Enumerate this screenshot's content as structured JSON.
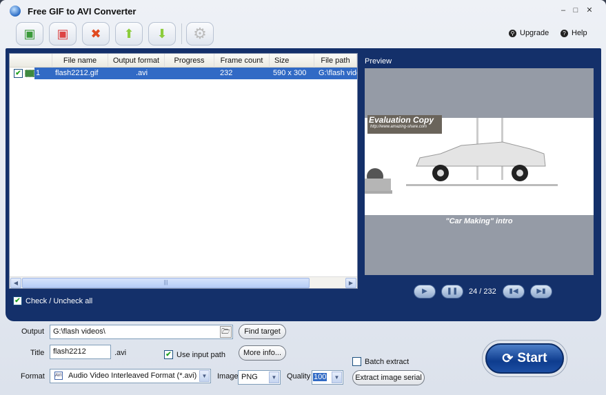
{
  "window": {
    "title": "Free GIF to AVI Converter"
  },
  "toolbar": {
    "upgrade": "Upgrade",
    "help": "Help"
  },
  "list": {
    "columns": [
      "",
      "File name",
      "Output format",
      "Progress",
      "Frame count",
      "Size",
      "File path"
    ],
    "rows": [
      {
        "index": "1",
        "checked": true,
        "file_name": "flash2212.gif",
        "output_format": ".avi",
        "progress": "",
        "frame_count": "232",
        "size": "590 x 300",
        "file_path": "G:\\flash videos\\"
      }
    ],
    "check_all_label": "Check / Uncheck all"
  },
  "preview": {
    "label": "Preview",
    "watermark_title": "Evaluation Copy",
    "watermark_url": "http://www.amazing-share.com",
    "caption": "\"Car Making\" intro",
    "counter": "24 / 232"
  },
  "settings": {
    "output_label": "Output",
    "output_value": "G:\\flash videos\\",
    "find_target": "Find target",
    "title_label": "Title",
    "title_value": "flash2212",
    "title_ext": ".avi",
    "use_input_path": "Use input path",
    "more_info": "More info...",
    "format_label": "Format",
    "format_value": "Audio Video Interleaved Format (*.avi)",
    "image_label": "Image",
    "image_value": "PNG",
    "quality_label": "Quality",
    "quality_value": "100",
    "batch_extract": "Batch extract",
    "extract_serial": "Extract image serial",
    "start": "Start"
  }
}
